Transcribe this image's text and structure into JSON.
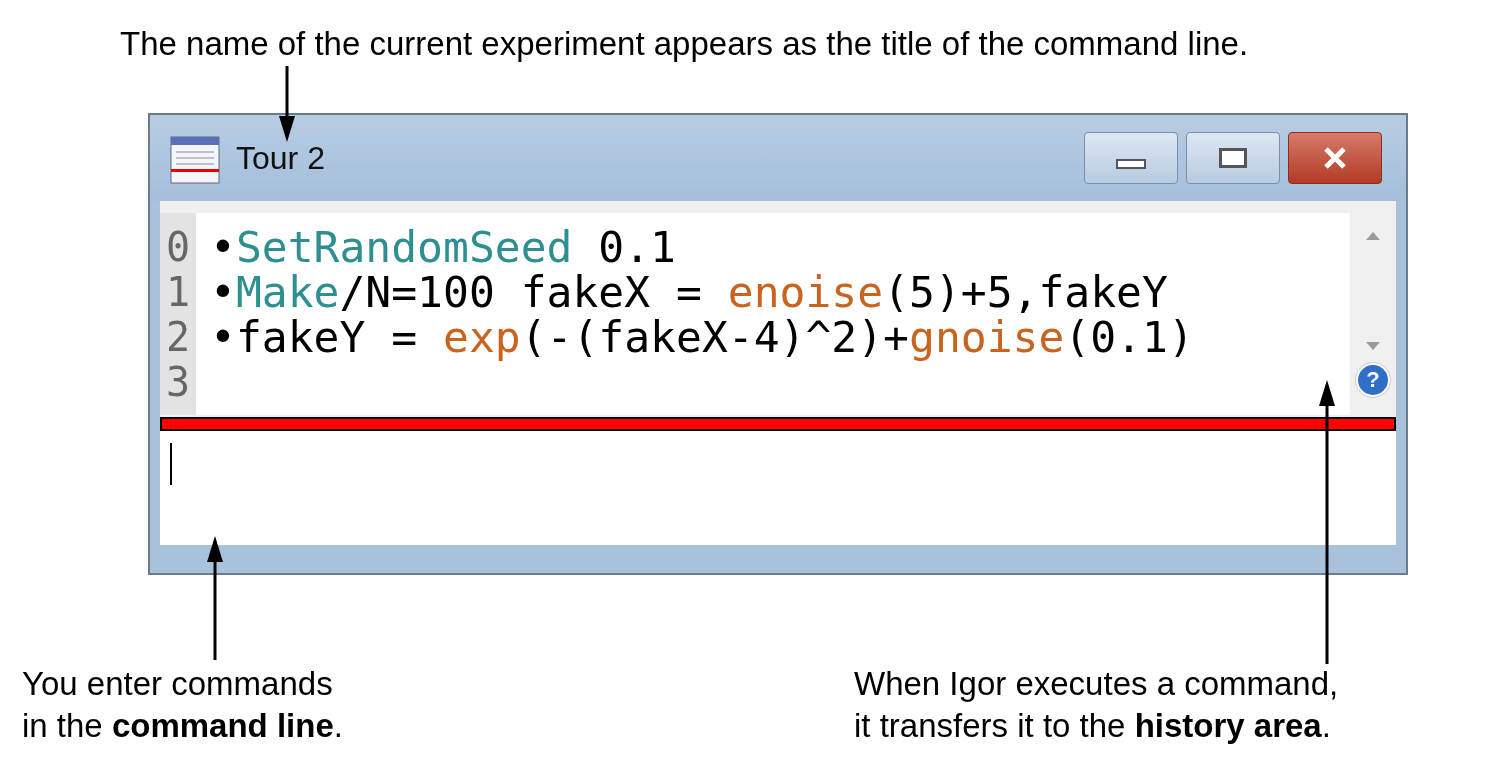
{
  "caption_top": "The name of the current experiment appears as the title of the command line.",
  "window": {
    "title": "Tour 2"
  },
  "history": {
    "lines": [
      {
        "number": "0",
        "segments": [
          {
            "kind": "plain",
            "text": "•"
          },
          {
            "kind": "command",
            "text": "SetRandomSeed"
          },
          {
            "kind": "plain",
            "text": " 0.1"
          }
        ]
      },
      {
        "number": "1",
        "segments": [
          {
            "kind": "plain",
            "text": "•"
          },
          {
            "kind": "command",
            "text": "Make"
          },
          {
            "kind": "plain",
            "text": "/N=100 fakeX = "
          },
          {
            "kind": "function",
            "text": "enoise"
          },
          {
            "kind": "plain",
            "text": "(5)+5,fakeY"
          }
        ]
      },
      {
        "number": "2",
        "segments": [
          {
            "kind": "plain",
            "text": "•fakeY = "
          },
          {
            "kind": "function",
            "text": "exp"
          },
          {
            "kind": "plain",
            "text": "(-(fakeX-4)^2)+"
          },
          {
            "kind": "function",
            "text": "gnoise"
          },
          {
            "kind": "plain",
            "text": "(0.1)"
          }
        ]
      },
      {
        "number": "3"
      }
    ],
    "help": "?"
  },
  "captions": [
    {
      "text": "You enter commands\nin the **command line**."
    },
    {
      "text": "When Igor executes a command,\nit transfers it to the **history area**."
    }
  ]
}
